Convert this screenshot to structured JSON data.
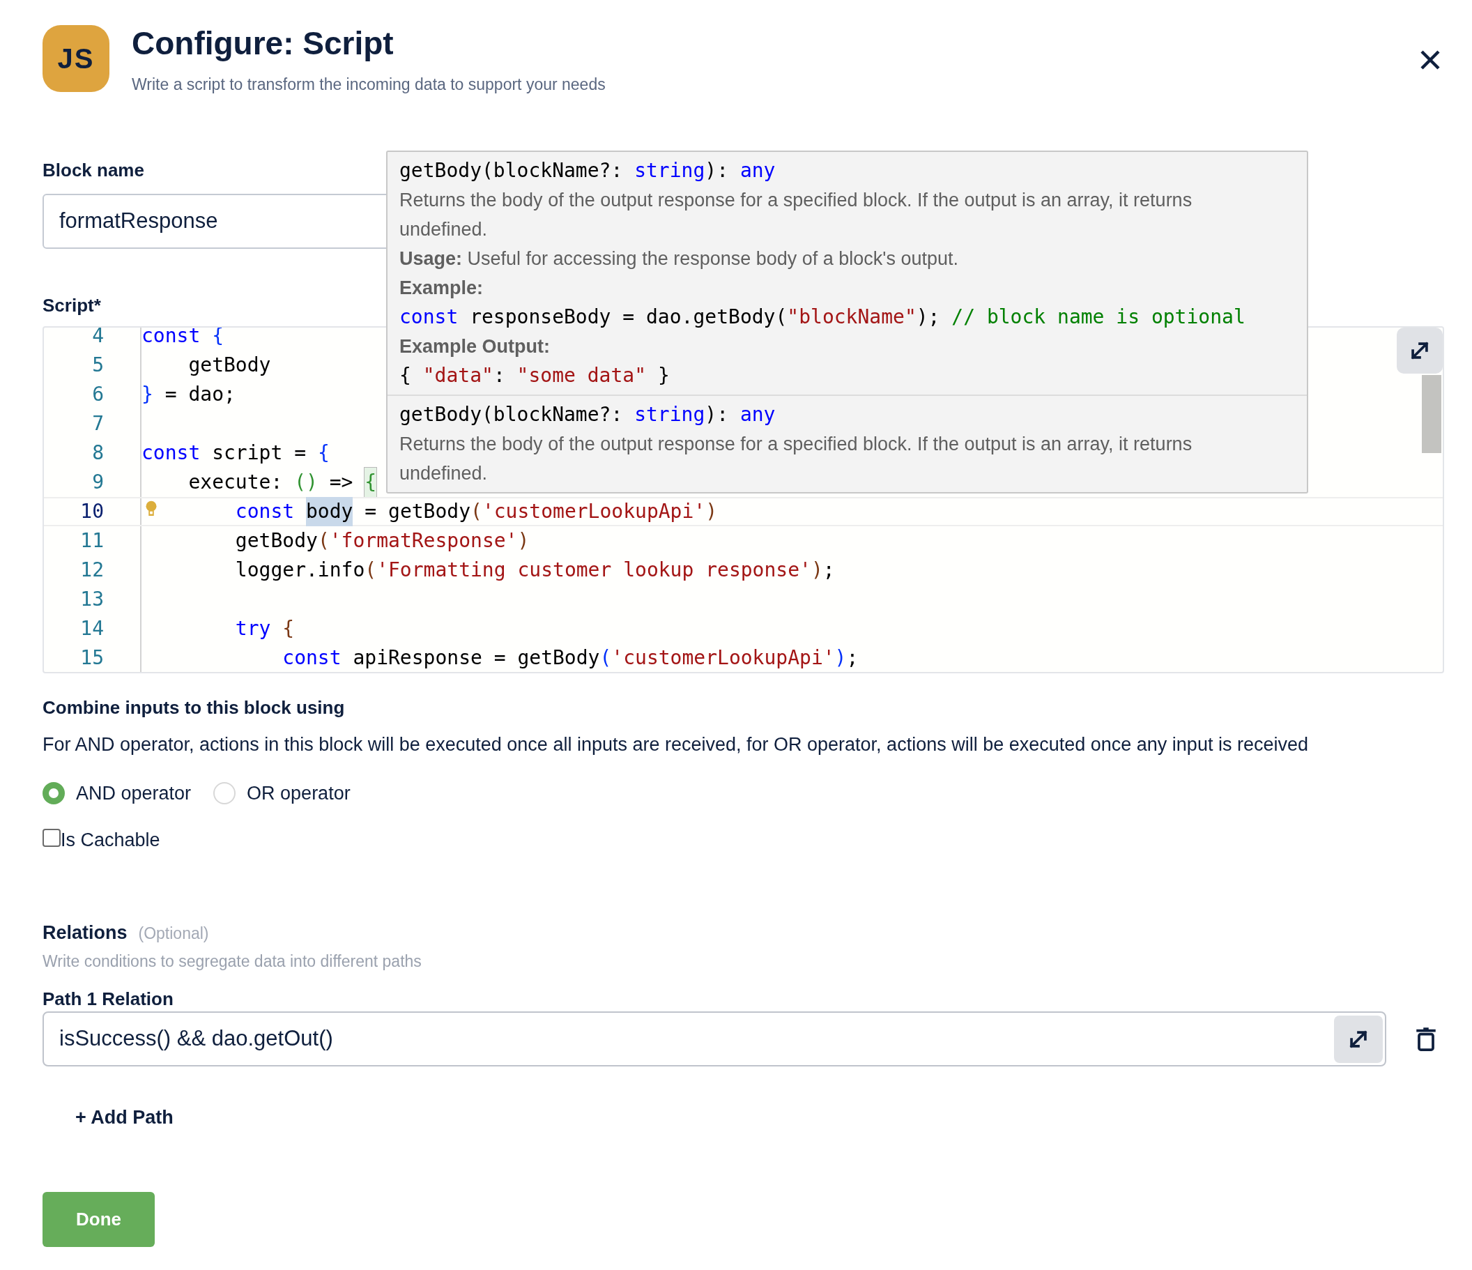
{
  "header": {
    "logo_text": "JS",
    "title": "Configure: Script",
    "subtitle": "Write a script to transform the incoming data to support your needs"
  },
  "block_name": {
    "label": "Block name",
    "value": "formatResponse"
  },
  "script": {
    "label": "Script*",
    "lines": [
      {
        "number": "4",
        "active": false,
        "tokens": [
          {
            "kind": "keyword",
            "text": "const "
          },
          {
            "kind": "bracket1",
            "text": "{"
          }
        ]
      },
      {
        "number": "5",
        "active": false,
        "tokens": [
          {
            "kind": "plain",
            "text": "    getBody"
          }
        ]
      },
      {
        "number": "6",
        "active": false,
        "tokens": [
          {
            "kind": "bracket1",
            "text": "}"
          },
          {
            "kind": "plain",
            "text": " = dao;"
          }
        ]
      },
      {
        "number": "7",
        "active": false
      },
      {
        "number": "8",
        "active": false,
        "tokens": [
          {
            "kind": "keyword",
            "text": "const"
          },
          {
            "kind": "plain",
            "text": " script = "
          },
          {
            "kind": "bracket1",
            "text": "{"
          }
        ]
      },
      {
        "number": "9",
        "active": false,
        "tokens": [
          {
            "kind": "plain",
            "text": "    execute: "
          },
          {
            "kind": "bracket2",
            "text": "()"
          },
          {
            "kind": "plain",
            "text": " => "
          },
          {
            "kind": "bracket2",
            "text": "{",
            "highlighted": true
          }
        ]
      },
      {
        "number": "10",
        "active": true,
        "tokens": [
          {
            "kind": "keyword",
            "text": "        const "
          },
          {
            "kind": "plain",
            "text": "body",
            "highlighted": true
          },
          {
            "kind": "plain",
            "text": " = getBody"
          },
          {
            "kind": "bracket3",
            "text": "("
          },
          {
            "kind": "string",
            "text": "'customerLookupApi'"
          },
          {
            "kind": "bracket3",
            "text": ")"
          }
        ]
      },
      {
        "number": "11",
        "active": false,
        "tokens": [
          {
            "kind": "plain",
            "text": "        getBody"
          },
          {
            "kind": "bracket3",
            "text": "("
          },
          {
            "kind": "string",
            "text": "'formatResponse'"
          },
          {
            "kind": "bracket3",
            "text": ")"
          }
        ]
      },
      {
        "number": "12",
        "active": false,
        "tokens": [
          {
            "kind": "plain",
            "text": "        logger.info"
          },
          {
            "kind": "bracket3",
            "text": "("
          },
          {
            "kind": "string",
            "text": "'Formatting customer lookup response'"
          },
          {
            "kind": "bracket3",
            "text": ")"
          },
          {
            "kind": "plain",
            "text": ";"
          }
        ]
      },
      {
        "number": "13",
        "active": false
      },
      {
        "number": "14",
        "active": false,
        "tokens": [
          {
            "kind": "keyword",
            "text": "        try"
          },
          {
            "kind": "bracket3",
            "text": " {"
          }
        ]
      },
      {
        "number": "15",
        "active": false,
        "tokens": [
          {
            "kind": "keyword",
            "text": "            const"
          },
          {
            "kind": "plain",
            "text": " apiResponse = getBody"
          },
          {
            "kind": "bracket1",
            "text": "("
          },
          {
            "kind": "string",
            "text": "'customerLookupApi'"
          },
          {
            "kind": "bracket1",
            "text": ")"
          },
          {
            "kind": "plain",
            "text": ";"
          }
        ]
      }
    ]
  },
  "tooltip": {
    "sections": [
      {
        "items": [
          {
            "kind": "code",
            "tokens": [
              {
                "kind": "plain",
                "text": "getBody(blockName?: "
              },
              {
                "kind": "type",
                "text": "string"
              },
              {
                "kind": "plain",
                "text": "): "
              },
              {
                "kind": "type",
                "text": "any"
              }
            ]
          },
          {
            "kind": "text",
            "text": "Returns the body of the output response for a specified block. If the output is an array, it returns undefined."
          },
          {
            "kind": "text",
            "text": "**Usage:** Useful for accessing the response body of a block's output."
          },
          {
            "kind": "text",
            "text": "**Example:**"
          },
          {
            "kind": "code",
            "tokens": [
              {
                "kind": "keyword",
                "text": "const"
              },
              {
                "kind": "plain",
                "text": " responseBody = dao.getBody("
              },
              {
                "kind": "string",
                "text": "\"blockName\""
              },
              {
                "kind": "plain",
                "text": "); "
              },
              {
                "kind": "comment",
                "text": "// block name is optional"
              }
            ]
          },
          {
            "kind": "text",
            "text": "**Example Output:**"
          },
          {
            "kind": "code",
            "tokens": [
              {
                "kind": "plain",
                "text": "{ "
              },
              {
                "kind": "string",
                "text": "\"data\""
              },
              {
                "kind": "plain",
                "text": ": "
              },
              {
                "kind": "string",
                "text": "\"some data\""
              },
              {
                "kind": "plain",
                "text": " }"
              }
            ]
          }
        ]
      },
      {
        "items": [
          {
            "kind": "code",
            "tokens": [
              {
                "kind": "plain",
                "text": "getBody(blockName?: "
              },
              {
                "kind": "type",
                "text": "string"
              },
              {
                "kind": "plain",
                "text": "): "
              },
              {
                "kind": "type",
                "text": "any"
              }
            ]
          },
          {
            "kind": "text",
            "text": "Returns the body of the output response for a specified block. If the output is an array, it returns undefined."
          }
        ]
      }
    ]
  },
  "combine": {
    "label": "Combine inputs to this block using",
    "description": "For AND operator, actions in this block will be executed once all inputs are received, for OR operator, actions will be executed once any input is received",
    "options": [
      {
        "label": "AND operator",
        "selected": true
      },
      {
        "label": "OR operator",
        "selected": false
      }
    ]
  },
  "cachable": {
    "label": "Is Cachable",
    "checked": false
  },
  "relations": {
    "title": "Relations",
    "optional": "(Optional)",
    "description": "Write conditions to segregate data into different paths",
    "paths": [
      {
        "label": "Path 1 Relation",
        "value": "isSuccess() && dao.getOut()"
      }
    ],
    "add_button": "+ Add Path"
  },
  "done_button": "Done"
}
